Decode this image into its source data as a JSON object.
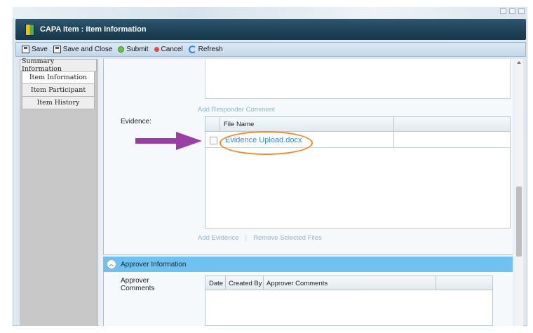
{
  "window": {
    "title": "CAPA Item : Item Information"
  },
  "toolbar": {
    "save": "Save",
    "save_close": "Save and Close",
    "submit": "Submit",
    "cancel": "Cancel",
    "refresh": "Refresh"
  },
  "nav": {
    "items": [
      {
        "label": "Summary Information"
      },
      {
        "label": "Item Information"
      },
      {
        "label": "Item Participant"
      },
      {
        "label": "Item History"
      }
    ]
  },
  "responder": {
    "add_comment": "Add Responder Comment"
  },
  "evidence": {
    "label": "Evidence:",
    "column_file_name": "File Name",
    "files": [
      {
        "name": "Evidence Upload.docx",
        "checked": false
      }
    ],
    "add": "Add Evidence",
    "remove": "Remove Selected Files"
  },
  "approver": {
    "section_title": "Approver Information",
    "comments_label": "Approver Comments",
    "columns": [
      "Date",
      "Created By",
      "Approver Comments"
    ]
  },
  "colors": {
    "header_dark": "#1f4359",
    "section_bar": "#6fc1ef",
    "link": "#2f8ee0",
    "highlight": "#f08a2c",
    "arrow": "#9b3fa6"
  },
  "icons": [
    "save-icon",
    "save-close-icon",
    "submit-icon",
    "cancel-icon",
    "refresh-icon",
    "collapse-icon",
    "arrow-annotation"
  ]
}
